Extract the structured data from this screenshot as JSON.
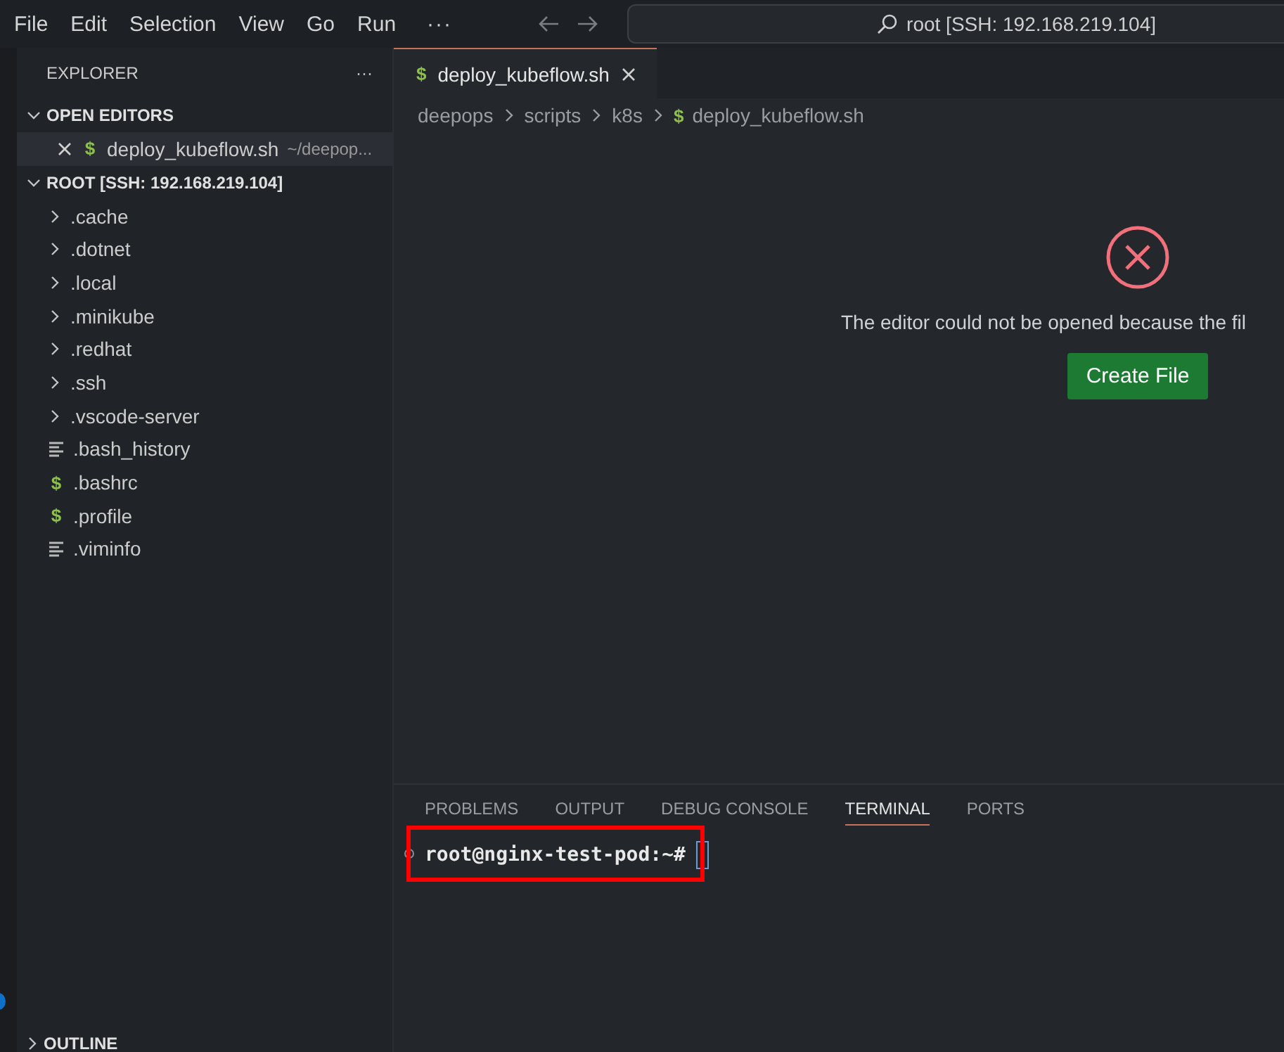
{
  "menu": [
    {
      "label": "File"
    },
    {
      "label": "Edit"
    },
    {
      "label": "Selection"
    },
    {
      "label": "View"
    },
    {
      "label": "Go"
    },
    {
      "label": "Run"
    }
  ],
  "menu_more": "···",
  "command_center": {
    "text": "root [SSH: 192.168.219.104]"
  },
  "sidebar": {
    "title": "EXPLORER",
    "more": "···",
    "open_editors": {
      "title": "OPEN EDITORS",
      "expanded": true,
      "items": [
        {
          "name": "deploy_kubeflow.sh",
          "path": "~/deepop...",
          "glyph": "$",
          "selected": true
        }
      ]
    },
    "root": {
      "title": "ROOT [SSH: 192.168.219.104]",
      "expanded": true,
      "children": [
        {
          "name": ".cache",
          "kind": "folder",
          "expanded": false
        },
        {
          "name": ".dotnet",
          "kind": "folder",
          "expanded": false
        },
        {
          "name": ".local",
          "kind": "folder",
          "expanded": false
        },
        {
          "name": ".minikube",
          "kind": "folder",
          "expanded": false
        },
        {
          "name": ".redhat",
          "kind": "folder",
          "expanded": false
        },
        {
          "name": ".ssh",
          "kind": "folder",
          "expanded": false
        },
        {
          "name": ".vscode-server",
          "kind": "folder",
          "expanded": false
        },
        {
          "name": ".bash_history",
          "kind": "text"
        },
        {
          "name": ".bashrc",
          "kind": "shell",
          "glyph": "$"
        },
        {
          "name": ".profile",
          "kind": "shell",
          "glyph": "$"
        },
        {
          "name": ".viminfo",
          "kind": "text"
        }
      ]
    },
    "outline": {
      "title": "OUTLINE",
      "expanded": false
    }
  },
  "editor": {
    "tabs": [
      {
        "label": "deploy_kubeflow.sh",
        "glyph": "$",
        "selected": true
      }
    ],
    "breadcrumbs": [
      {
        "label": "deepops"
      },
      {
        "label": "scripts"
      },
      {
        "label": "k8s"
      },
      {
        "label": "deploy_kubeflow.sh",
        "glyph": "$"
      }
    ],
    "message": "The editor could not be opened because the fil",
    "button": "Create File"
  },
  "panel": {
    "tabs": [
      {
        "label": "PROBLEMS",
        "selected": false
      },
      {
        "label": "OUTPUT",
        "selected": false
      },
      {
        "label": "DEBUG CONSOLE",
        "selected": false
      },
      {
        "label": "TERMINAL",
        "selected": true
      },
      {
        "label": "PORTS",
        "selected": false
      }
    ],
    "terminal": {
      "prompt": "root@nginx-test-pod:~#",
      "highlighted": true
    }
  }
}
